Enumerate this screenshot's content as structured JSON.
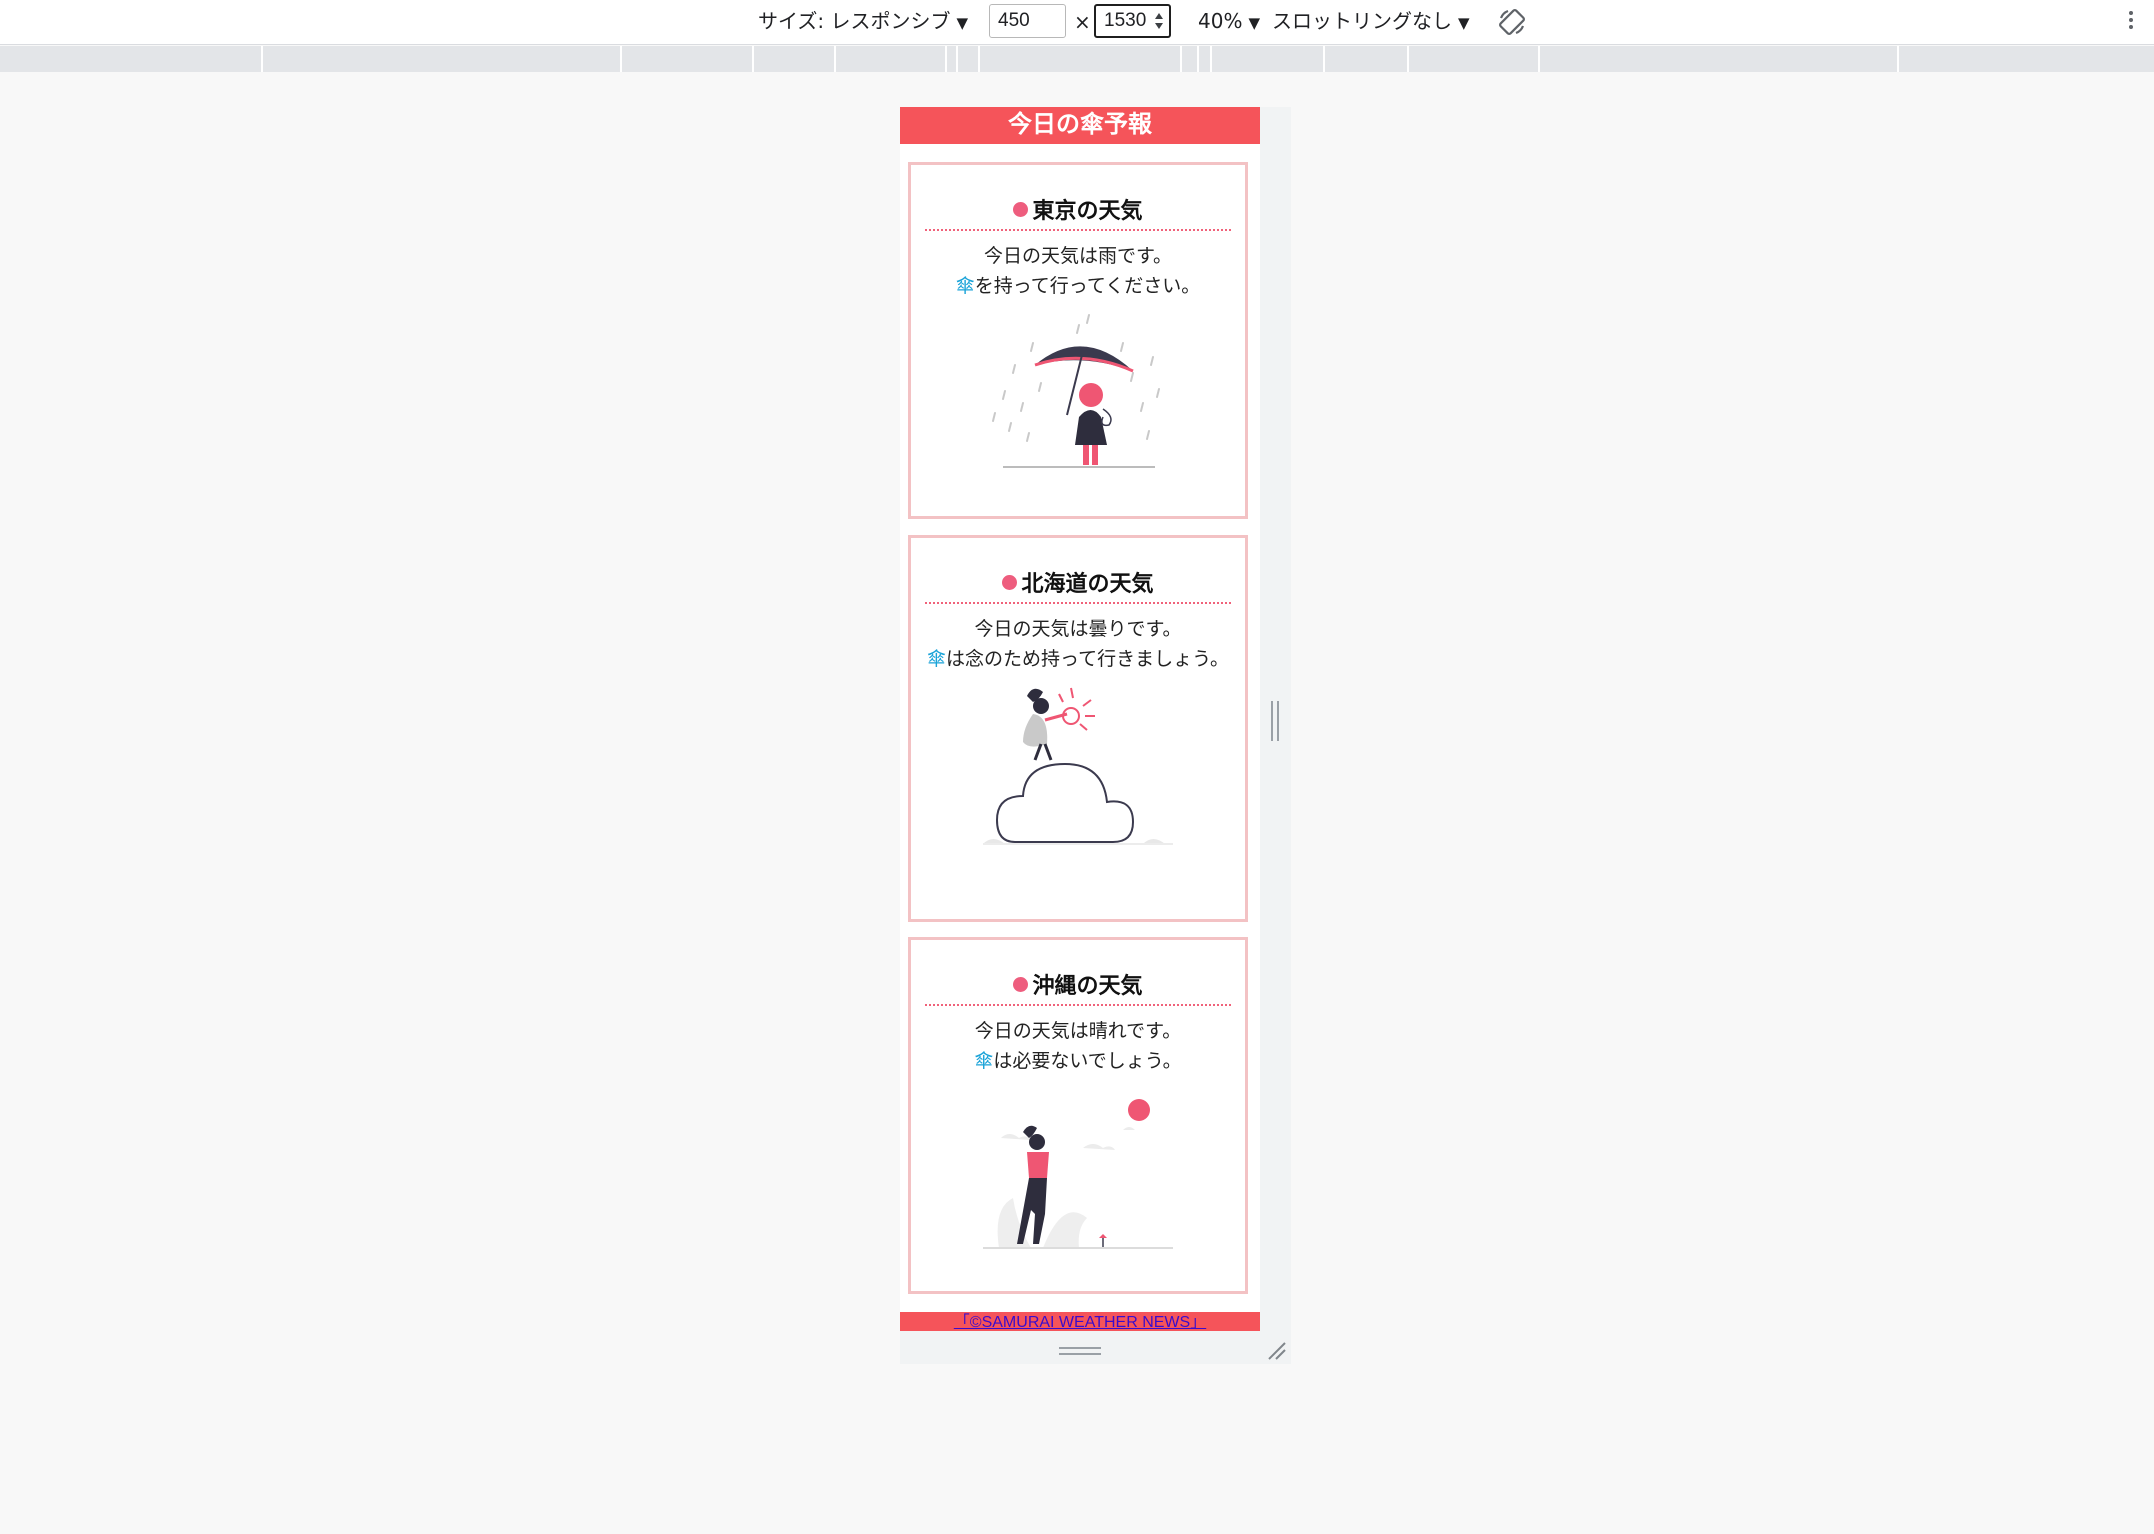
{
  "toolbar": {
    "size_label": "サイズ: レスポンシブ",
    "width_value": "450",
    "times": "×",
    "height_value": "1530",
    "zoom_label": "40%",
    "throttle_label": "スロットリングなし"
  },
  "page": {
    "header_title": "今日の傘予報",
    "cards": [
      {
        "title": "東京の天気",
        "line1": "今日の天気は雨です。",
        "umbrella": "傘",
        "line2": "を持って行ってください。"
      },
      {
        "title": "北海道の天気",
        "line1": "今日の天気は曇りです。",
        "umbrella": "傘",
        "line2": "は念のため持って行きましょう。"
      },
      {
        "title": "沖縄の天気",
        "line1": "今日の天気は晴れです。",
        "umbrella": "傘",
        "line2": "は必要ないでしょう。"
      }
    ],
    "footer_link": "「©SAMURAI WEATHER NEWS」"
  },
  "colors": {
    "accent": "#f5545a",
    "card_border": "#f3c2c4",
    "dot": "#ee5d7e",
    "umbrella_text": "#1aa3d8"
  },
  "icons": [
    "dropdown-caret-icon",
    "rotate-icon",
    "more-vert-icon",
    "spinner-icon",
    "resize-handle-icon"
  ]
}
